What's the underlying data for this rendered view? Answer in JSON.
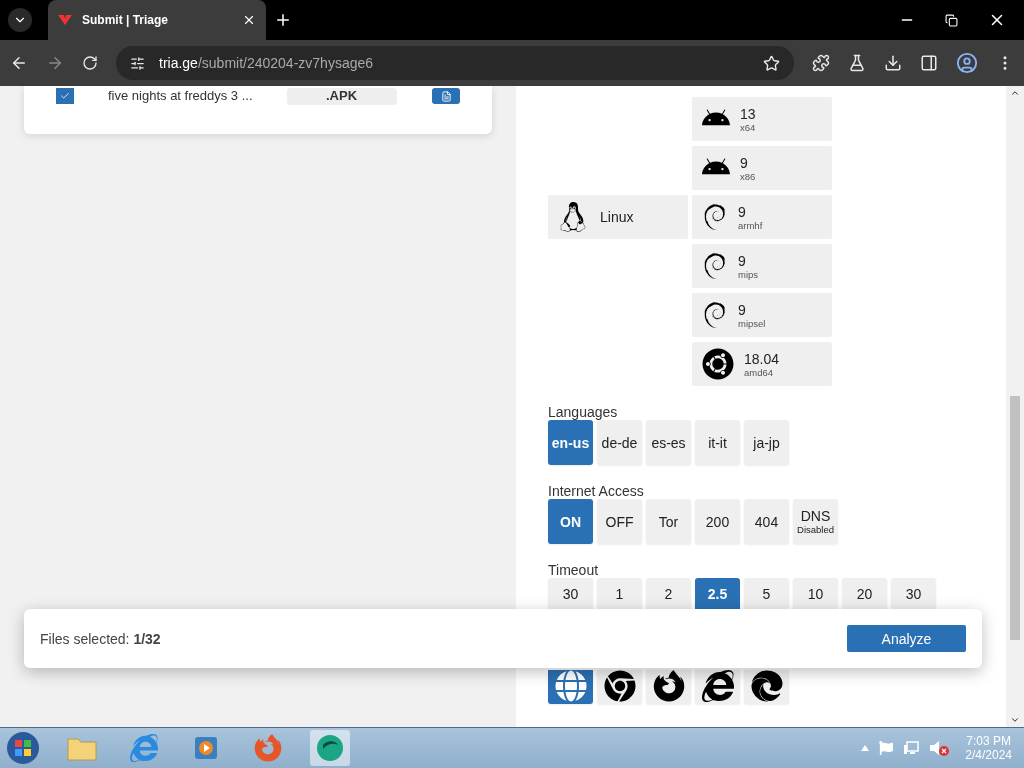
{
  "browser": {
    "tab_title": "Submit | Triage",
    "url_host": "tria.ge",
    "url_path": "/submit/240204-zv7hysage6"
  },
  "file_card": {
    "file_name": "five nights at freddys 3 ...",
    "extension": ".APK",
    "checked": true
  },
  "os_groups": [
    {
      "kind": "android",
      "versions": [
        {
          "version": "13",
          "arch": "x64"
        },
        {
          "version": "9",
          "arch": "x86"
        }
      ]
    },
    {
      "kind": "linux",
      "label": "Linux",
      "versions": [
        {
          "version": "9",
          "arch": "armhf",
          "kind": "debian"
        },
        {
          "version": "9",
          "arch": "mips",
          "kind": "debian"
        },
        {
          "version": "9",
          "arch": "mipsel",
          "kind": "debian"
        },
        {
          "version": "18.04",
          "arch": "amd64",
          "kind": "ubuntu"
        }
      ]
    }
  ],
  "languages": {
    "title": "Languages",
    "options": [
      {
        "label": "en-us",
        "selected": true
      },
      {
        "label": "de-de",
        "selected": false
      },
      {
        "label": "es-es",
        "selected": false
      },
      {
        "label": "it-it",
        "selected": false
      },
      {
        "label": "ja-jp",
        "selected": false
      }
    ]
  },
  "internet_access": {
    "title": "Internet Access",
    "options": [
      {
        "label": "ON",
        "selected": true
      },
      {
        "label": "OFF",
        "selected": false
      },
      {
        "label": "Tor",
        "selected": false
      },
      {
        "label": "200",
        "selected": false
      },
      {
        "label": "404",
        "selected": false
      },
      {
        "label": "DNS",
        "sub": "Disabled",
        "selected": false
      }
    ]
  },
  "timeout": {
    "title": "Timeout",
    "options": [
      {
        "label": "30",
        "selected": false
      },
      {
        "label": "1",
        "selected": false
      },
      {
        "label": "2",
        "selected": false
      },
      {
        "label": "2.5",
        "selected": true
      },
      {
        "label": "5",
        "selected": false
      },
      {
        "label": "10",
        "selected": false
      },
      {
        "label": "20",
        "selected": false
      },
      {
        "label": "30",
        "selected": false
      }
    ]
  },
  "browsers": [
    {
      "kind": "globe",
      "selected": true
    },
    {
      "kind": "chrome",
      "selected": false
    },
    {
      "kind": "firefox",
      "selected": false
    },
    {
      "kind": "ie",
      "selected": false
    },
    {
      "kind": "edge",
      "selected": false
    }
  ],
  "selection_bar": {
    "label": "Files selected: ",
    "count": "1/32",
    "button": "Analyze"
  },
  "taskbar": {
    "time": "7:03 PM",
    "date": "2/4/2024"
  }
}
